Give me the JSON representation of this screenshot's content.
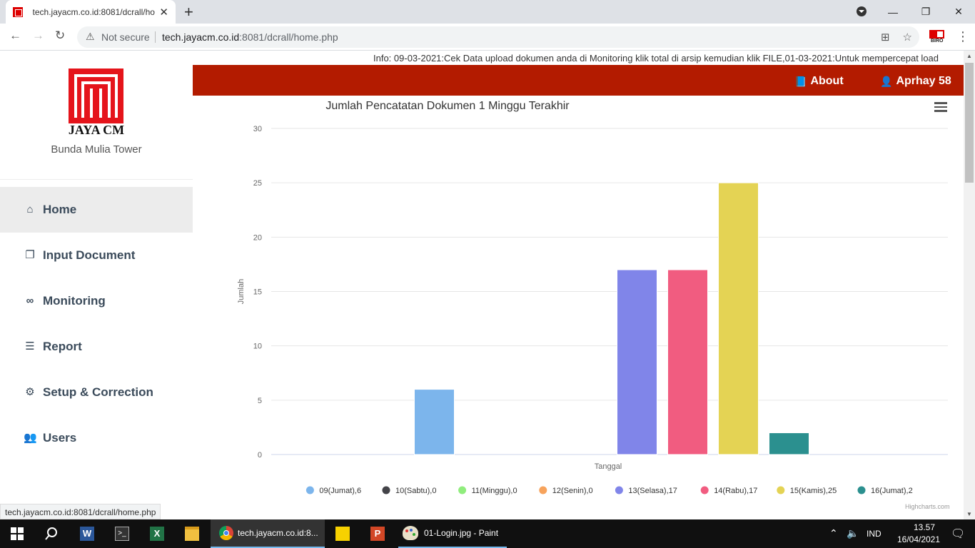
{
  "browser": {
    "tab_title": "tech.jayacm.co.id:8081/dcrall/ho",
    "security_label": "Not secure",
    "url_host": "tech.jayacm.co.id",
    "url_path": ":8081/dcrall/home.php",
    "status_url": "tech.jayacm.co.id:8081/dcrall/home.php",
    "extension_label": "BIRO"
  },
  "sidebar": {
    "logo_text": "JAYA CM",
    "company": "Bunda Mulia Tower",
    "items": [
      {
        "label": "Home",
        "icon": "home-icon",
        "active": true
      },
      {
        "label": "Input Document",
        "icon": "documents-icon",
        "active": false
      },
      {
        "label": "Monitoring",
        "icon": "binoculars-icon",
        "active": false
      },
      {
        "label": "Report",
        "icon": "file-text-icon",
        "active": false
      },
      {
        "label": "Setup & Correction",
        "icon": "gear-icon",
        "active": false
      },
      {
        "label": "Users",
        "icon": "users-icon",
        "active": false
      }
    ]
  },
  "ticker": "Info: 09-03-2021:Cek Data upload dokumen anda di Monitoring klik total di arsip kemudian klik FILE,01-03-2021:Untuk mempercepat load",
  "topbar": {
    "about_label": "About",
    "user_label": "Aprhay 58",
    "color": "#b31b00"
  },
  "chart_data": {
    "type": "bar",
    "title": "Jumlah Pencatatan Dokumen 1 Minggu Terakhir",
    "xlabel": "Tanggal",
    "ylabel": "Jumlah",
    "ylim": [
      0,
      30
    ],
    "yticks": [
      0,
      5,
      10,
      15,
      20,
      25,
      30
    ],
    "grid": true,
    "legend_position": "bottom",
    "series": [
      {
        "name": "09(Jumat),6",
        "value": 6,
        "color": "#7cb5ec"
      },
      {
        "name": "10(Sabtu),0",
        "value": 0,
        "color": "#434348"
      },
      {
        "name": "11(Minggu),0",
        "value": 0,
        "color": "#90ed7d"
      },
      {
        "name": "12(Senin),0",
        "value": 0,
        "color": "#f7a35c"
      },
      {
        "name": "13(Selasa),17",
        "value": 17,
        "color": "#8085e9"
      },
      {
        "name": "14(Rabu),17",
        "value": 17,
        "color": "#f15c80"
      },
      {
        "name": "15(Kamis),25",
        "value": 25,
        "color": "#e4d354"
      },
      {
        "name": "16(Jumat),2",
        "value": 2,
        "color": "#2b908f"
      }
    ],
    "credits": "Highcharts.com"
  },
  "taskbar": {
    "apps": [
      {
        "label": "tech.jayacm.co.id:8...",
        "icon": "chrome-icon"
      },
      {
        "label": "01-Login.jpg - Paint",
        "icon": "paint-icon"
      }
    ],
    "language": "IND",
    "time": "13.57",
    "date": "16/04/2021"
  }
}
